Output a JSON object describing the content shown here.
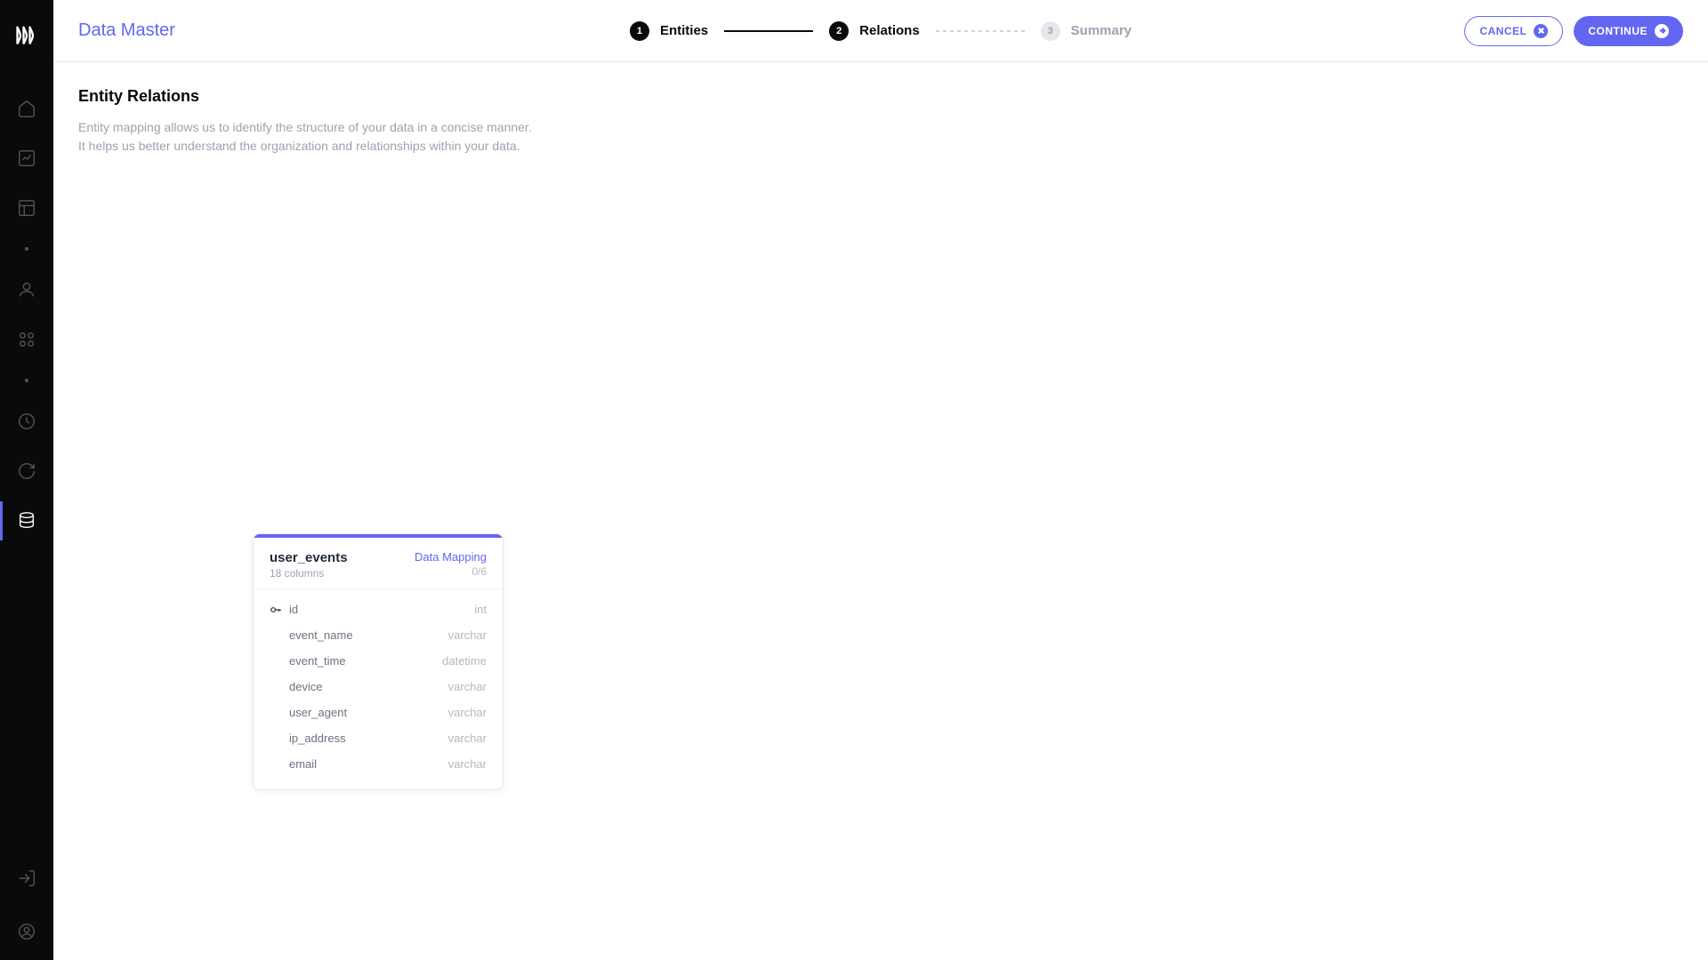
{
  "app_title": "Data Master",
  "header": {
    "cancel_label": "CANCEL",
    "continue_label": "CONTINUE"
  },
  "stepper": {
    "steps": [
      {
        "num": "1",
        "label": "Entities"
      },
      {
        "num": "2",
        "label": "Relations"
      },
      {
        "num": "3",
        "label": "Summary"
      }
    ]
  },
  "section": {
    "title": "Entity Relations",
    "desc_line1": "Entity mapping allows us to identify the structure of your data in a concise manner.",
    "desc_line2": "It helps us better understand the organization and relationships within your data."
  },
  "entity": {
    "name": "user_events",
    "col_count": "18 columns",
    "mapping_label": "Data Mapping",
    "mapping_count": "0/6",
    "fields": [
      {
        "name": "id",
        "type": "int",
        "is_key": true
      },
      {
        "name": "event_name",
        "type": "varchar",
        "is_key": false
      },
      {
        "name": "event_time",
        "type": "datetime",
        "is_key": false
      },
      {
        "name": "device",
        "type": "varchar",
        "is_key": false
      },
      {
        "name": "user_agent",
        "type": "varchar",
        "is_key": false
      },
      {
        "name": "ip_address",
        "type": "varchar",
        "is_key": false
      },
      {
        "name": "email",
        "type": "varchar",
        "is_key": false
      }
    ]
  }
}
